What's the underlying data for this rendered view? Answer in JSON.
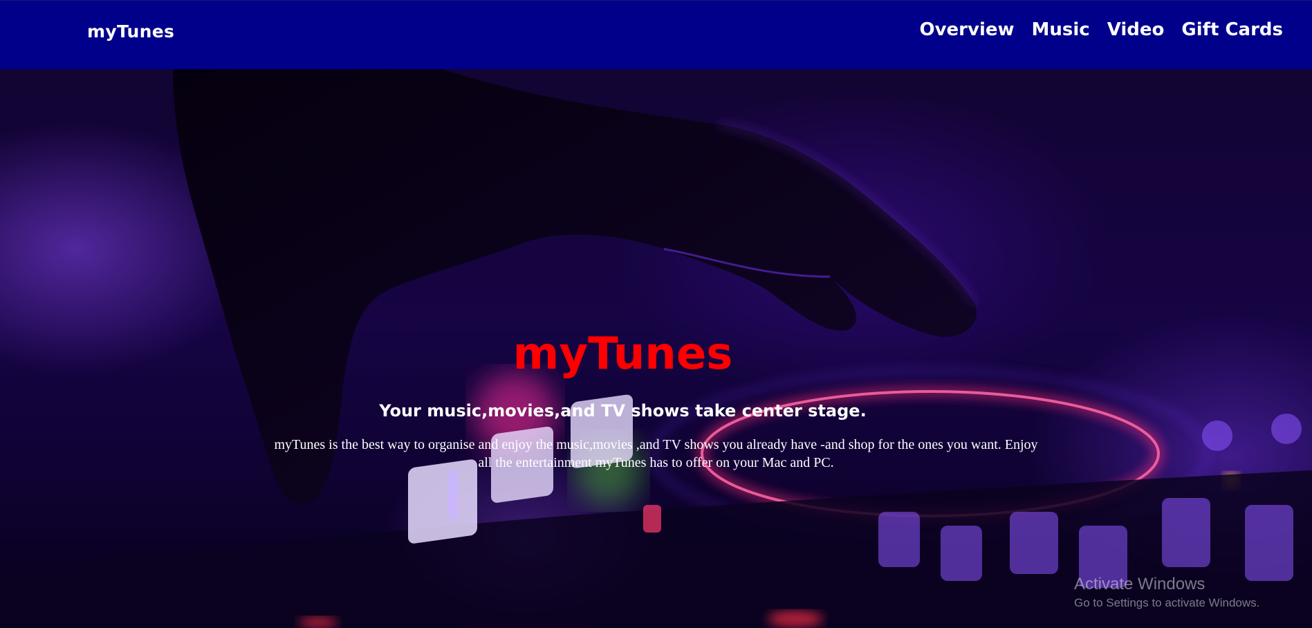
{
  "navbar": {
    "brand": "myTunes",
    "links": [
      "Overview",
      "Music",
      "Video",
      "Gift Cards"
    ]
  },
  "hero": {
    "title": "myTunes",
    "subtitle": "Your music,movies,and TV shows take center stage.",
    "body": "myTunes is the best way to organise and enjoy the music,movies ,and TV shows you already have -and shop for the ones you want. Enjoy all the entertainment myTunes has to offer on your Mac and PC.",
    "background_image": "dj-mixer-hand-purple-photo"
  },
  "watermark": {
    "title": "Activate Windows",
    "subtitle": "Go to Settings to activate Windows."
  },
  "colors": {
    "navbar_bg": "#00008b",
    "hero_title": "#ff0000",
    "text": "#ffffff"
  }
}
